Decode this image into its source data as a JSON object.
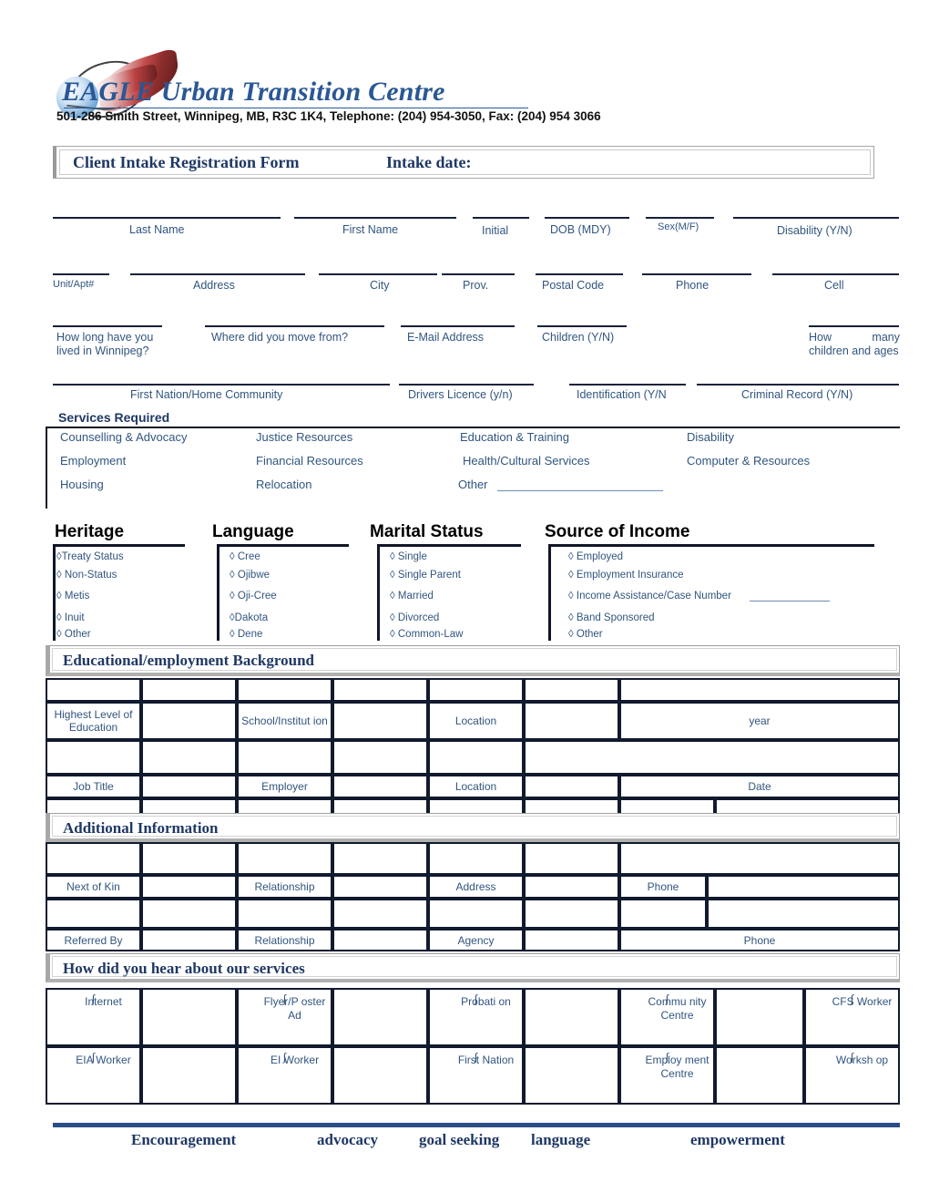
{
  "header": {
    "org_name": "EAGLE Urban Transition Centre",
    "address": "501-286 Smith Street, Winnipeg, MB, R3C 1K4, Telephone: (204) 954-3050, Fax: (204) 954 3066",
    "logo_icon": "eagle-feather-logo"
  },
  "title_bar": {
    "form_title": "Client Intake Registration Form",
    "intake_date_label": "Intake date:"
  },
  "identity_fields": {
    "row1": [
      {
        "label": "Last Name"
      },
      {
        "label": "First Name"
      },
      {
        "label": "Initial"
      },
      {
        "label": "DOB (MDY)"
      },
      {
        "label": "Sex(M/F)"
      },
      {
        "label": "Disability (Y/N)"
      }
    ],
    "row2": [
      {
        "label": "Unit/Apt#"
      },
      {
        "label": "Address"
      },
      {
        "label": "City"
      },
      {
        "label": "Prov."
      },
      {
        "label": "Postal Code"
      },
      {
        "label": "Phone"
      },
      {
        "label": "Cell"
      }
    ],
    "row3": [
      {
        "label": "How long have you lived in Winnipeg?"
      },
      {
        "label": "Where did you move from?"
      },
      {
        "label": "E-Mail Address"
      },
      {
        "label": "Children (Y/N)"
      },
      {
        "label": "How many children and ages"
      }
    ],
    "row4": [
      {
        "label": "First Nation/Home Community"
      },
      {
        "label": "Drivers Licence (y/n)"
      },
      {
        "label": "Identification (Y/N"
      },
      {
        "label": "Criminal Record (Y/N)"
      }
    ]
  },
  "services": {
    "heading": "Services Required",
    "items": [
      "Counselling & Advocacy",
      "Justice Resources",
      "Education & Training",
      "Disability",
      "Employment",
      "Financial Resources",
      "Health/Cultural Services",
      "Computer & Resources",
      "Housing",
      "Relocation",
      "Other"
    ]
  },
  "categories": [
    {
      "title": "Heritage",
      "options": [
        "◊Treaty Status",
        "◊ Non-Status",
        "◊ Metis",
        "◊ Inuit",
        "◊ Other"
      ]
    },
    {
      "title": "Language",
      "options": [
        "◊ Cree",
        "◊ Ojibwe",
        "◊ Oji-Cree",
        "◊Dakota",
        "◊ Dene"
      ]
    },
    {
      "title": "Marital Status",
      "options": [
        "◊ Single",
        "◊ Single Parent",
        "◊ Married",
        "◊ Divorced",
        "◊ Common-Law"
      ]
    },
    {
      "title": "Source of Income",
      "options": [
        "◊ Employed",
        "◊ Employment Insurance",
        "◊ Income Assistance/Case Number",
        "◊ Band Sponsored",
        "◊ Other"
      ]
    }
  ],
  "education_section": {
    "band_title": "Educational/employment Background",
    "labels": {
      "highest_level": "Highest Level of Education",
      "school": "School/Institut ion",
      "location1": "Location",
      "year": "year",
      "job_title": "Job Title",
      "employer": "Employer",
      "location2": "Location",
      "date": "Date"
    }
  },
  "additional_section": {
    "band_title": "Additional Information",
    "labels": {
      "next_of_kin": "Next of Kin",
      "relationship1": "Relationship",
      "address": "Address",
      "phone1": "Phone",
      "referred_by": "Referred By",
      "relationship2": "Relationship",
      "agency": "Agency",
      "phone2": "Phone"
    }
  },
  "hear_about_section": {
    "band_title": "How did you hear about our services",
    "checkbox_glyph": "∫",
    "options_row1": [
      "Internet",
      "Flyer/P oster Ad",
      "Probati on",
      "Commu nity Centre",
      "CFS Worker"
    ],
    "options_row2": [
      "EIA Worker",
      "EI Worker",
      "First Nation",
      "Employ ment Centre",
      "Worksh op"
    ]
  },
  "footer": {
    "words": [
      "Encouragement",
      "advocacy",
      "goal seeking",
      "language",
      "empowerment"
    ]
  },
  "colors": {
    "heading_navy": "#1f3864",
    "label_blue": "#31557f",
    "logo_blue": "#2a5795",
    "rule_dark": "#111a2e",
    "band_gray": "#a8a8a8",
    "footer_rule": "#2a4d86"
  }
}
